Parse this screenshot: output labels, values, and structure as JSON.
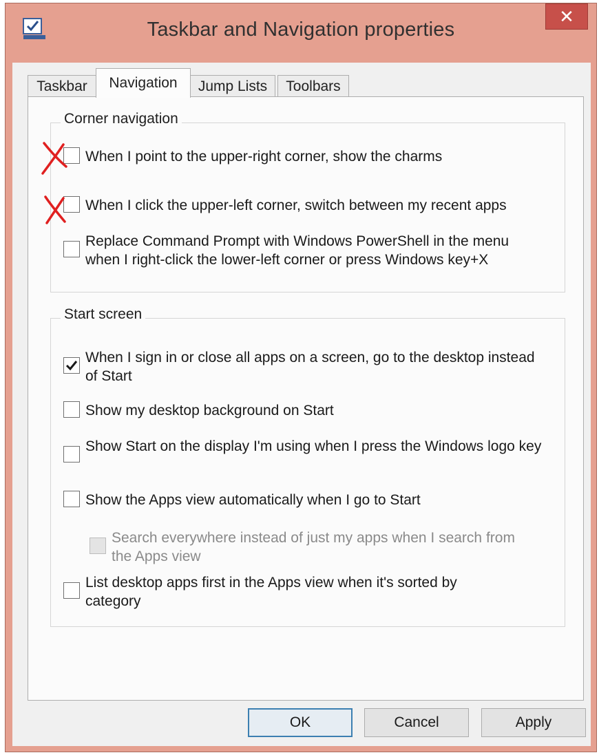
{
  "window": {
    "title": "Taskbar and Navigation properties",
    "close_glyph": "✕"
  },
  "tabs": [
    {
      "label": "Taskbar",
      "active": false
    },
    {
      "label": "Navigation",
      "active": true
    },
    {
      "label": "Jump Lists",
      "active": false
    },
    {
      "label": "Toolbars",
      "active": false
    }
  ],
  "corner_navigation": {
    "title": "Corner navigation",
    "options": [
      {
        "label": "When I point to the upper-right corner, show the charms",
        "checked": false,
        "annotated_x": true
      },
      {
        "label": "When I click the upper-left corner, switch between my recent apps",
        "checked": false,
        "annotated_x": true
      },
      {
        "label": "Replace Command Prompt with Windows PowerShell in the menu when I right-click the lower-left corner or press Windows key+X",
        "checked": false
      }
    ]
  },
  "start_screen": {
    "title": "Start screen",
    "options": [
      {
        "label": "When I sign in or close all apps on a screen, go to the desktop instead of Start",
        "checked": true
      },
      {
        "label": "Show my desktop background on Start",
        "checked": false
      },
      {
        "label": "Show Start on the display I'm using when I press the Windows logo key",
        "checked": false
      },
      {
        "label": "Show the Apps view automatically when I go to Start",
        "checked": false
      },
      {
        "label": "Search everywhere instead of just my apps when I search from the Apps view",
        "checked": false,
        "disabled": true
      },
      {
        "label": "List desktop apps first in the Apps view when it's sorted by category",
        "checked": false
      }
    ]
  },
  "buttons": {
    "ok": "OK",
    "cancel": "Cancel",
    "apply": "Apply"
  },
  "colors": {
    "frame": "#e5a090",
    "close_button": "#c7504a",
    "annotation": "#e02020",
    "default_button_border": "#3c7fb1"
  }
}
